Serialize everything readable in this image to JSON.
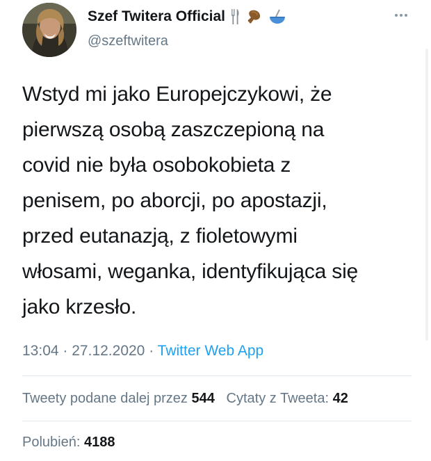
{
  "author": {
    "display_name": "Szef Twitera Official",
    "handle": "@szeftwitera",
    "name_emojis": [
      "fork-and-knife-icon",
      "chicken-leg-icon",
      "bowl-with-spoon-icon"
    ]
  },
  "tweet": {
    "lines": [
      "Wstyd mi jako Europejczykowi, że",
      "pierwszą osobą zaszczepioną na",
      "covid nie była osobokobieta z",
      "penisem, po aborcji, po apostazji,",
      "przed eutanazją, z fioletowymi",
      "włosami, weganka, identyfikująca się",
      "jako krzesło."
    ]
  },
  "meta": {
    "time": "13:04",
    "separator": "·",
    "date": "27.12.2020",
    "source": "Twitter Web App"
  },
  "stats": {
    "retweets_label": "Tweety podane dalej przez",
    "retweets_count": "544",
    "quotes_label": "Cytaty z Tweeta:",
    "quotes_count": "42",
    "likes_label": "Polubień:",
    "likes_count": "4188"
  },
  "colors": {
    "link": "#1da1f2",
    "secondary_text": "#657786",
    "primary_text": "#14171a"
  }
}
